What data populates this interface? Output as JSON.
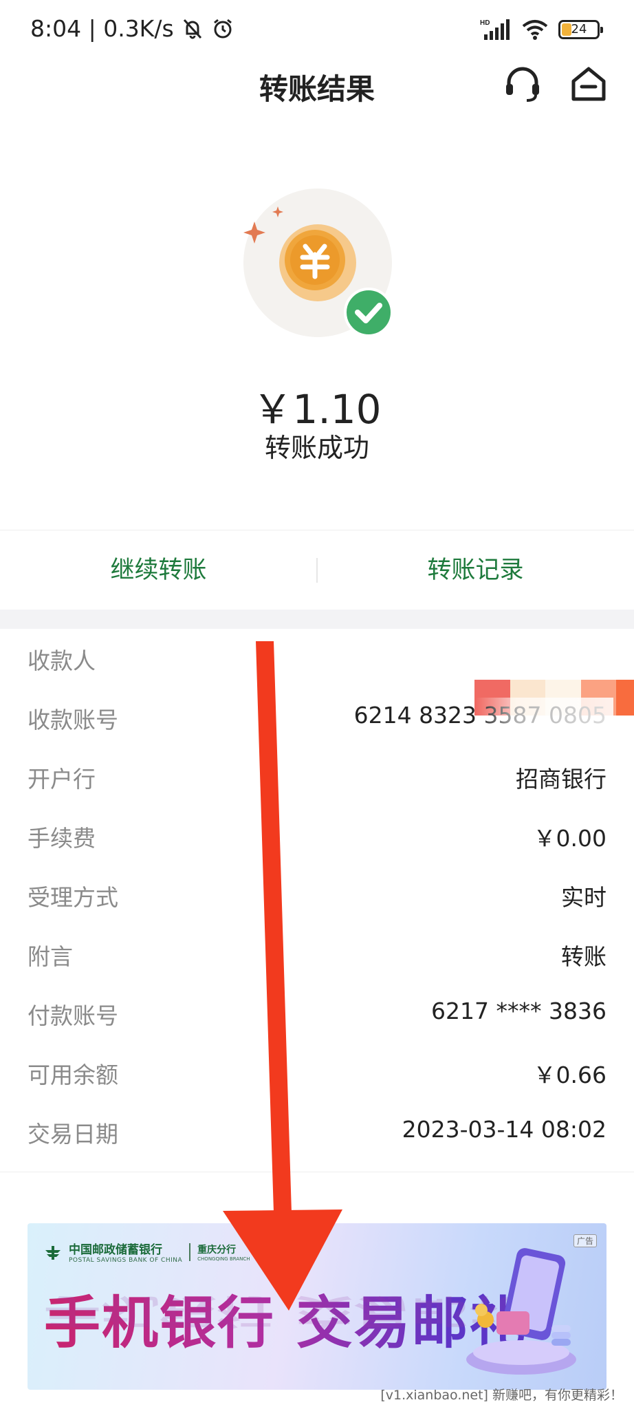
{
  "status_bar": {
    "time_speed": "8:04 | 0.3K/s",
    "network_label": "HD",
    "battery": "24"
  },
  "header": {
    "title": "转账结果"
  },
  "result": {
    "amount": "￥1.10",
    "status": "转账成功"
  },
  "actions": {
    "continue_label": "继续转账",
    "records_label": "转账记录"
  },
  "details": [
    {
      "label": "收款人",
      "value": ""
    },
    {
      "label": "收款账号",
      "value": "6214 8323 3587 0805"
    },
    {
      "label": "开户行",
      "value": "招商银行"
    },
    {
      "label": "手续费",
      "value": "￥0.00"
    },
    {
      "label": "受理方式",
      "value": "实时"
    },
    {
      "label": "附言",
      "value": "转账"
    },
    {
      "label": "付款账号",
      "value": "6217 **** 3836"
    },
    {
      "label": "可用余额",
      "value": "￥0.66"
    },
    {
      "label": "交易日期",
      "value": "2023-03-14 08:02"
    }
  ],
  "banner": {
    "bank_name": "中国邮政储蓄银行",
    "bank_name_en": "POSTAL SAVINGS BANK OF CHINA",
    "branch": "重庆分行",
    "branch_en": "CHONGQING BRANCH",
    "ad_tag": "广告",
    "slogan": "手机银行 交易邮礼"
  },
  "watermark": "[v1.xianbao.net] 新赚吧，有你更精彩！",
  "colors": {
    "accent_green": "#1e7a3c",
    "success_green": "#3fae68",
    "coin_orange": "#f0a63c",
    "arrow_red": "#f23a1e"
  },
  "icons": {
    "header_left": "headset-icon",
    "header_right": "home-icon",
    "hero": "coin-success-icon"
  }
}
